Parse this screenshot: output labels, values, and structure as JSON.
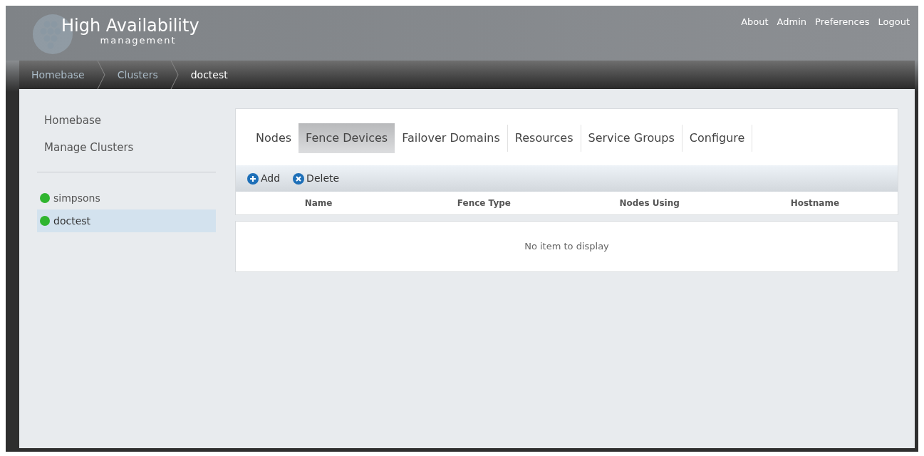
{
  "header": {
    "title": "High Availability",
    "subtitle": "management",
    "links": [
      "About",
      "Admin",
      "Preferences",
      "Logout"
    ]
  },
  "breadcrumb": [
    {
      "label": "Homebase",
      "current": false
    },
    {
      "label": "Clusters",
      "current": false
    },
    {
      "label": "doctest",
      "current": true
    }
  ],
  "sidebar": {
    "items": [
      "Homebase",
      "Manage Clusters"
    ],
    "clusters": [
      {
        "name": "simpsons",
        "color": "#2fb52f",
        "selected": false
      },
      {
        "name": "doctest",
        "color": "#2fb52f",
        "selected": true
      }
    ]
  },
  "tabs": [
    {
      "label": "Nodes",
      "selected": false
    },
    {
      "label": "Fence Devices",
      "selected": true
    },
    {
      "label": "Failover Domains",
      "selected": false
    },
    {
      "label": "Resources",
      "selected": false
    },
    {
      "label": "Service Groups",
      "selected": false
    },
    {
      "label": "Configure",
      "selected": false
    }
  ],
  "toolbar": [
    {
      "kind": "add",
      "label": "Add"
    },
    {
      "kind": "delete",
      "label": "Delete"
    }
  ],
  "table": {
    "columns": [
      "Name",
      "Fence Type",
      "Nodes Using",
      "Hostname"
    ],
    "empty_message": "No item to display"
  }
}
